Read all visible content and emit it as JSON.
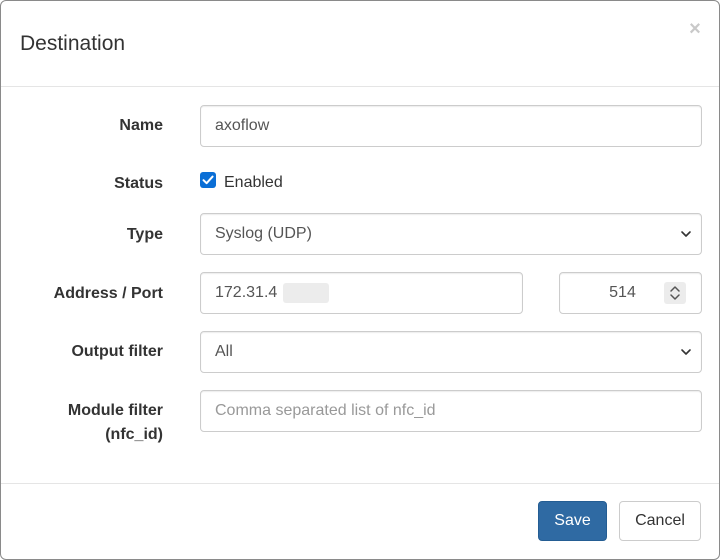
{
  "modal": {
    "title": "Destination",
    "close_label": "×"
  },
  "form": {
    "name": {
      "label": "Name",
      "value": "axoflow"
    },
    "status": {
      "label": "Status",
      "checkbox_label": "Enabled",
      "checked": true
    },
    "type": {
      "label": "Type",
      "selected": "Syslog (UDP)"
    },
    "address_port": {
      "label": "Address / Port",
      "address_value": "172.31.4",
      "port_value": "514"
    },
    "output_filter": {
      "label": "Output filter",
      "selected": "All"
    },
    "module_filter": {
      "label_line1": "Module filter",
      "label_line2": "(nfc_id)",
      "placeholder": "Comma separated list of nfc_id"
    }
  },
  "footer": {
    "save_label": "Save",
    "cancel_label": "Cancel"
  },
  "colors": {
    "primary": "#2f6aa3",
    "checkbox": "#0b6fd6"
  },
  "icons": [
    "close-icon",
    "checkmark-icon",
    "chevron-down-icon",
    "spinner-arrows-icon"
  ]
}
